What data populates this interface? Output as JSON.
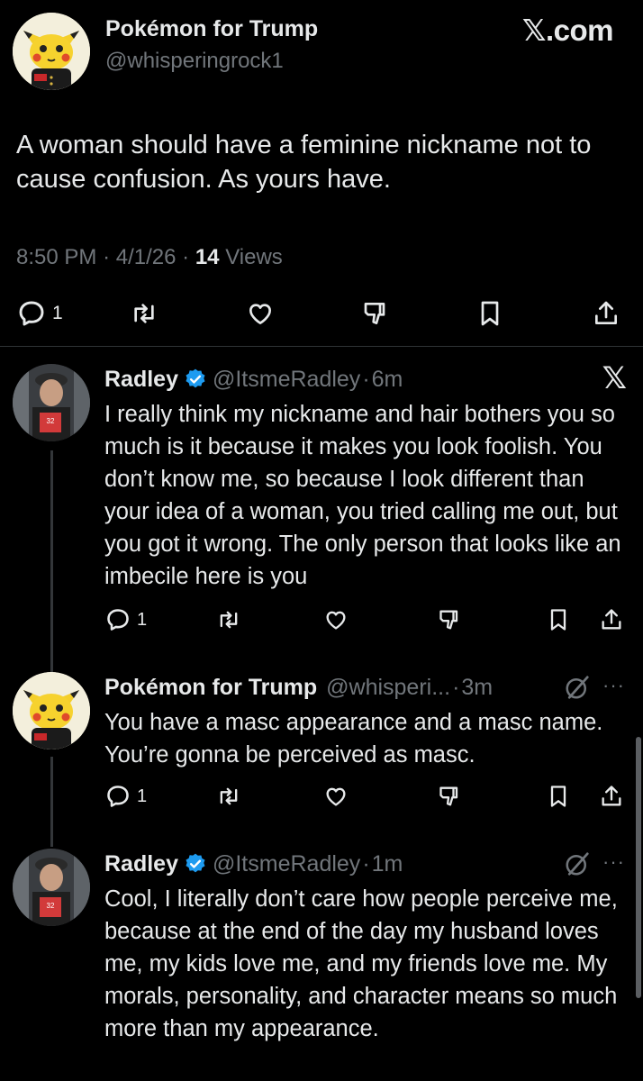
{
  "main_tweet": {
    "author_name": "Pokémon for Trump",
    "author_handle": "@whisperingrock1",
    "brand": "𝕏.com",
    "text": "A woman should have a feminine nickname not to cause confusion. As yours have.",
    "time": "8:50 PM",
    "date": "4/1/26",
    "views_count": "14",
    "views_label": "Views",
    "reply_count": "1",
    "avatar_icon": "pikachu-avatar"
  },
  "replies": [
    {
      "author_name": "Radley",
      "author_handle": "@ItsmeRadley",
      "time": "6m",
      "verified": true,
      "text": "I really think my nickname and hair bothers you so much is it because it makes you look foolish. You don’t know me, so because I look different than your idea of a woman, you tried calling me out, but you got it wrong. The only person that looks like an imbecile here is you",
      "reply_count": "1",
      "corner": "𝕏"
    },
    {
      "author_name": "Pokémon for Trump",
      "author_handle": "@whisperi...",
      "time": "3m",
      "verified": false,
      "text": "You have a masc appearance and a masc name. You’re gonna be perceived as masc.",
      "reply_count": "1",
      "more": "···"
    },
    {
      "author_name": "Radley",
      "author_handle": "@ItsmeRadley",
      "time": "1m",
      "verified": true,
      "text": "Cool, I literally don’t care how people perceive me, because at the end of the day my husband loves me, my kids love me, and my friends love me. My morals, personality, and character means so much more than my appearance.",
      "more": "···"
    }
  ],
  "separator": "·",
  "colors": {
    "background": "#000000",
    "text": "#e7e9ea",
    "muted": "#71767b",
    "verified": "#1d9bf0",
    "divider": "#2f3336"
  }
}
